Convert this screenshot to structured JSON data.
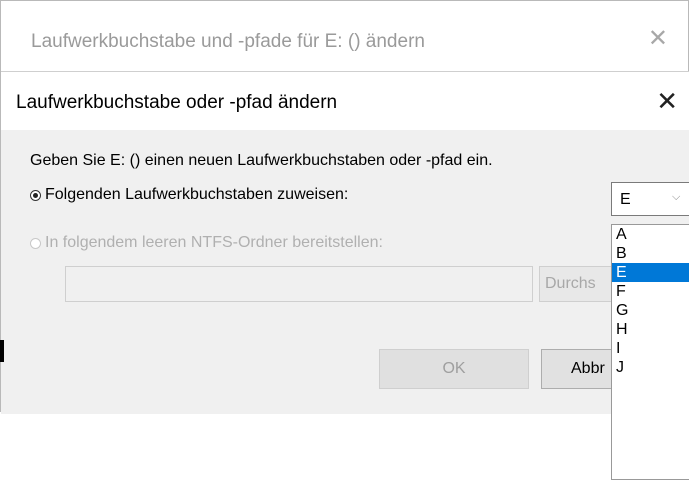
{
  "outer_dialog": {
    "title": "Laufwerkbuchstabe und -pfade für E: () ändern",
    "close_glyph": "✕"
  },
  "inner_dialog": {
    "title": "Laufwerkbuchstabe oder -pfad ändern",
    "close_glyph": "✕",
    "description": "Geben Sie E: () einen neuen Laufwerkbuchstaben oder -pfad ein.",
    "option_assign_letter": "Folgenden Laufwerkbuchstaben zuweisen:",
    "option_mount_folder": "In folgendem leeren NTFS-Ordner bereitstellen:",
    "folder_path_value": "",
    "browse_label": "Durchs",
    "ok_label": "OK",
    "cancel_label": "Abbr"
  },
  "drive_letter_select": {
    "selected": "E",
    "chevron_icon": "chevron-down-icon",
    "options": [
      "A",
      "B",
      "E",
      "F",
      "G",
      "H",
      "I",
      "J"
    ]
  },
  "colors": {
    "accent": "#0078d7",
    "dialog_bg": "#f0f0f0"
  }
}
